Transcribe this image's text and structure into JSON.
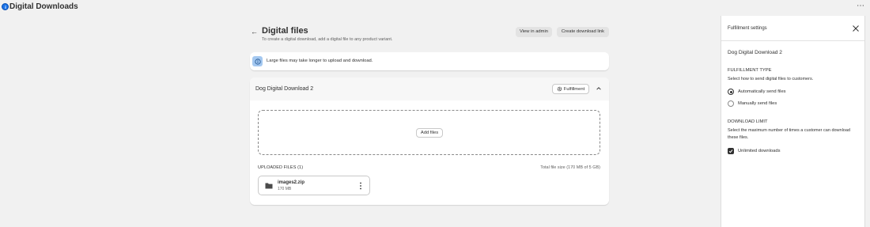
{
  "app": {
    "title": "Digital Downloads",
    "more_label": "⋯",
    "icon": "info-circle-icon"
  },
  "page": {
    "back_icon": "arrow-left-icon",
    "back_label": "←",
    "title": "Digital files",
    "subtitle": "To create a digital download, add a digital file to any product variant."
  },
  "actions": {
    "view_admin": "View in admin",
    "create_link": "Create download link"
  },
  "banner": {
    "icon": "info-icon",
    "text": "Large files may take longer to upload and download.",
    "accent_color": "#a4c8f0"
  },
  "product_card": {
    "title": "Dog Digital Download 2",
    "fulfillment_label": "Fulfillment",
    "add_files_label": "Add files",
    "uploaded_label": "UPLOADED FILES (1)",
    "total_size": "Total file size (170 MB of 5 GB)",
    "files": [
      {
        "name": "images2.zip",
        "size": "170 MB",
        "icon": "folder-icon"
      }
    ]
  },
  "panel": {
    "title": "Fulfillment settings",
    "product_name": "Dog Digital Download 2",
    "fulfillment_type": {
      "heading": "FULFILLMENT TYPE",
      "description": "Select how to send digital files to customers.",
      "options": [
        {
          "label": "Automatically send files",
          "selected": true
        },
        {
          "label": "Manually send files",
          "selected": false
        }
      ]
    },
    "download_limit": {
      "heading": "DOWNLOAD LIMIT",
      "description": "Select the maximum number of times a customer can download these files.",
      "unlimited_label": "Unlimited downloads",
      "unlimited_checked": true
    }
  }
}
